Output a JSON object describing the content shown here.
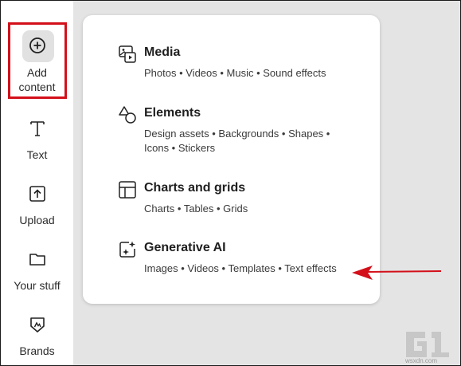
{
  "sidebar": {
    "items": [
      {
        "label": "Add\ncontent",
        "icon": "plus-circle-icon"
      },
      {
        "label": "Text",
        "icon": "text-t-icon"
      },
      {
        "label": "Upload",
        "icon": "upload-icon"
      },
      {
        "label": "Your stuff",
        "icon": "folder-icon"
      },
      {
        "label": "Brands",
        "icon": "brand-icon"
      }
    ]
  },
  "panel": {
    "sections": [
      {
        "title": "Media",
        "description": "Photos • Videos • Music • Sound effects",
        "icon": "media-icon"
      },
      {
        "title": "Elements",
        "description": "Design assets • Backgrounds • Shapes • Icons • Stickers",
        "icon": "shapes-icon"
      },
      {
        "title": "Charts and grids",
        "description": "Charts • Tables • Grids",
        "icon": "grid-layout-icon"
      },
      {
        "title": "Generative AI",
        "description": "Images • Videos • Templates • Text effects",
        "icon": "sparkle-icon"
      }
    ]
  },
  "annotation": {
    "highlight_color": "#d3101a"
  },
  "watermark": {
    "text": "wsxdn.com"
  }
}
